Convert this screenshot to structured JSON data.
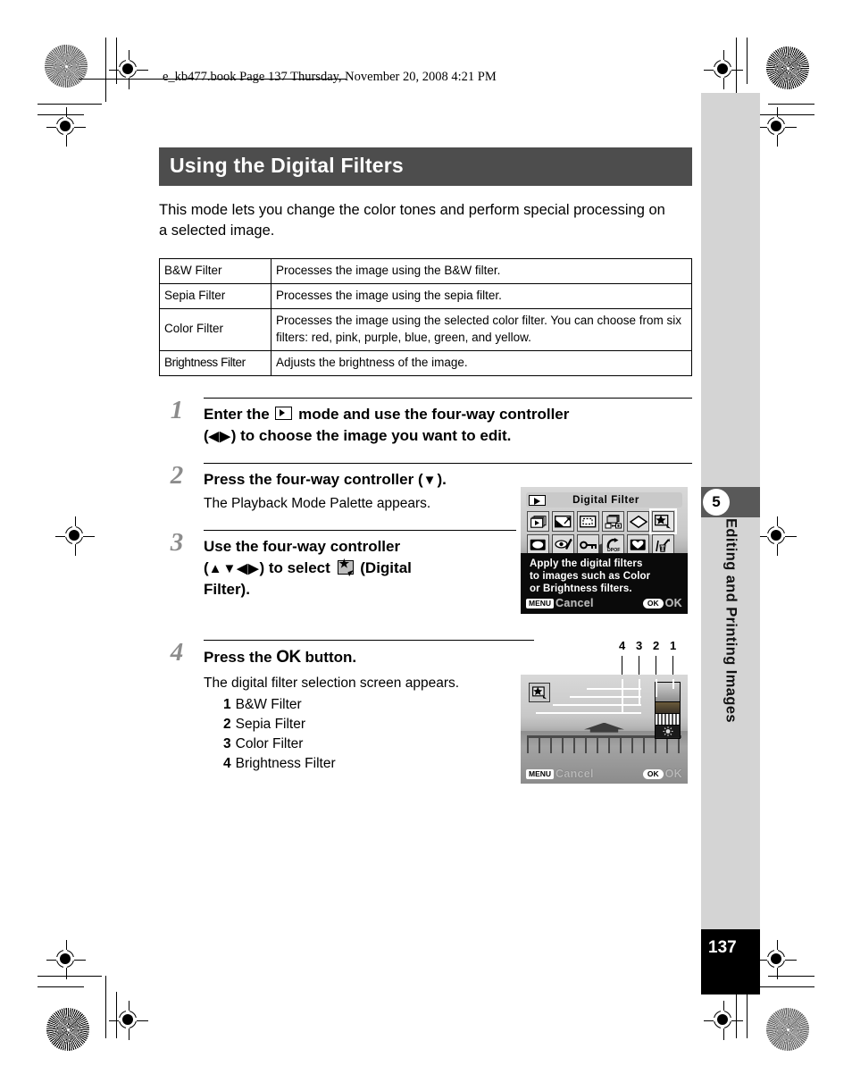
{
  "header": {
    "book_line": "e_kb477.book  Page 137  Thursday, November 20, 2008  4:21 PM"
  },
  "chapter_tab": {
    "number": "5",
    "title": "Editing and Printing Images",
    "page_number": "137"
  },
  "section": {
    "title": "Using the Digital Filters",
    "intro": "This mode lets you change the color tones and perform special processing on a selected image."
  },
  "filter_table": {
    "rows": [
      {
        "name": "B&W Filter",
        "desc": "Processes the image using the B&W filter."
      },
      {
        "name": "Sepia Filter",
        "desc": "Processes the image using the sepia filter."
      },
      {
        "name": "Color Filter",
        "desc": "Processes the image using the selected color filter. You can choose from six filters: red, pink, purple, blue, green, and yellow."
      },
      {
        "name": "Brightness Filter",
        "desc": "Adjusts the brightness of the image."
      }
    ]
  },
  "steps": [
    {
      "num": "1",
      "head_a": "Enter the",
      "head_b": "mode and use the four-way controller",
      "head_c": "(",
      "arrows": "◀▶",
      "head_d": ") to choose the image you want to edit."
    },
    {
      "num": "2",
      "head_a": "Press the four-way controller (",
      "arrows": "▼",
      "head_d": ").",
      "sub": "The Playback Mode Palette appears."
    },
    {
      "num": "3",
      "head_a": "Use the four-way controller",
      "head_c": "(",
      "arrows": "▲▼◀▶",
      "head_b": ") to select",
      "head_d": "(Digital",
      "head_e": "Filter)."
    },
    {
      "num": "4",
      "head_a": "Press the",
      "ok": "OK",
      "head_d": "button.",
      "sub": "The digital filter selection screen appears.",
      "list": [
        {
          "n": "1",
          "label": "B&W Filter"
        },
        {
          "n": "2",
          "label": "Sepia Filter"
        },
        {
          "n": "3",
          "label": "Color Filter"
        },
        {
          "n": "4",
          "label": "Brightness Filter"
        }
      ]
    }
  ],
  "lcd_palette": {
    "title": "Digital Filter",
    "title_icon": "playback-icon",
    "icons_row1": [
      "slideshow-icon",
      "resize-icon",
      "cropping-icon",
      "image-copy-icon",
      "image-rotation-icon",
      "digital-filter-icon"
    ],
    "icons_row2": [
      "frame-composite-icon",
      "red-eye-icon",
      "protect-key-icon",
      "dpof-icon",
      "start-screen-icon",
      "delete-icon"
    ],
    "selected_icon": "digital-filter-icon",
    "description_lines": [
      "Apply the digital filters",
      "to images such as Color",
      "or Brightness filters."
    ],
    "menu_badge": "MENU",
    "menu_label": "Cancel",
    "ok_badge": "OK",
    "ok_label": "OK"
  },
  "lcd_filter_screen": {
    "icon": "digital-filter-icon",
    "callout_numbers": [
      "4",
      "3",
      "2",
      "1"
    ],
    "menu_badge": "MENU",
    "menu_label": "Cancel",
    "ok_badge": "OK",
    "ok_label": "OK"
  },
  "colors": {
    "section_bar": "#4d4d4d",
    "tab_gray": "#d4d4d4",
    "tab_band": "#595959",
    "page_box": "#000000",
    "step_number": "#8c8c8c"
  }
}
